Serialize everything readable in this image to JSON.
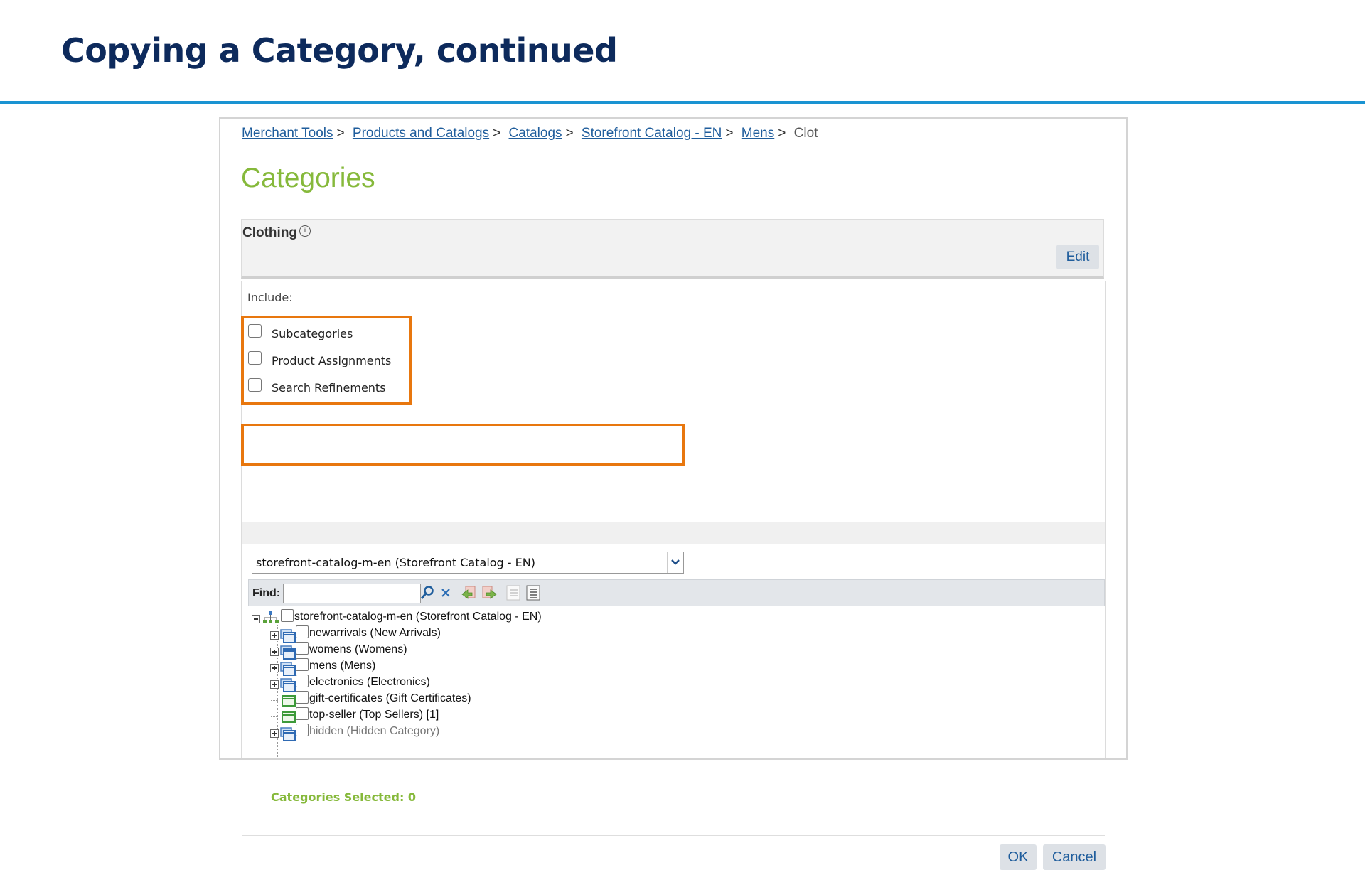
{
  "slide": {
    "title": "Copying a Category, continued"
  },
  "breadcrumb": [
    {
      "label": "Merchant Tools",
      "link": true
    },
    {
      "label": "Products and Catalogs",
      "link": true
    },
    {
      "label": "Catalogs",
      "link": true
    },
    {
      "label": "Storefront Catalog - EN",
      "link": true
    },
    {
      "label": "Mens",
      "link": true
    },
    {
      "label": "Clot",
      "link": false
    }
  ],
  "breadcrumb_separator": ">",
  "page": {
    "heading": "Categories"
  },
  "category": {
    "name": "Clothing",
    "info_icon": "info-icon",
    "edit_label": "Edit"
  },
  "dialog": {
    "include_label": "Include:",
    "options": [
      {
        "label": "Subcategories",
        "checked": false
      },
      {
        "label": "Product Assignments",
        "checked": false
      },
      {
        "label": "Search Refinements",
        "checked": false
      }
    ],
    "catalog_select": {
      "value": "storefront-catalog-m-en (Storefront Catalog - EN)"
    },
    "find": {
      "label": "Find:",
      "value": ""
    },
    "toolbar_icons": [
      "search-icon",
      "clear-icon",
      "move-left-icon",
      "move-right-icon",
      "collapse-all-icon",
      "expand-all-icon"
    ],
    "tree": {
      "root": {
        "label": "storefront-catalog-m-en (Storefront Catalog - EN)",
        "expanded": true
      },
      "children": [
        {
          "label": "newarrivals (New Arrivals)",
          "expandable": true,
          "type": "folder",
          "muted": false
        },
        {
          "label": "womens (Womens)",
          "expandable": true,
          "type": "folder",
          "muted": false
        },
        {
          "label": "mens (Mens)",
          "expandable": true,
          "type": "folder",
          "muted": false
        },
        {
          "label": "electronics (Electronics)",
          "expandable": true,
          "type": "folder",
          "muted": false
        },
        {
          "label": "gift-certificates (Gift Certificates)",
          "expandable": false,
          "type": "leaf",
          "muted": false
        },
        {
          "label": "top-seller (Top Sellers) [1]",
          "expandable": false,
          "type": "leaf",
          "muted": false
        },
        {
          "label": "hidden (Hidden Category)",
          "expandable": true,
          "type": "folder",
          "muted": true
        }
      ]
    },
    "categories_selected": "Categories Selected: 0",
    "ok_label": "OK",
    "cancel_label": "Cancel"
  },
  "colors": {
    "title": "#0d2a5c",
    "rule": "#1a93d2",
    "heading_green": "#86b93b",
    "link": "#1f5d9c",
    "highlight": "#e8770e"
  }
}
